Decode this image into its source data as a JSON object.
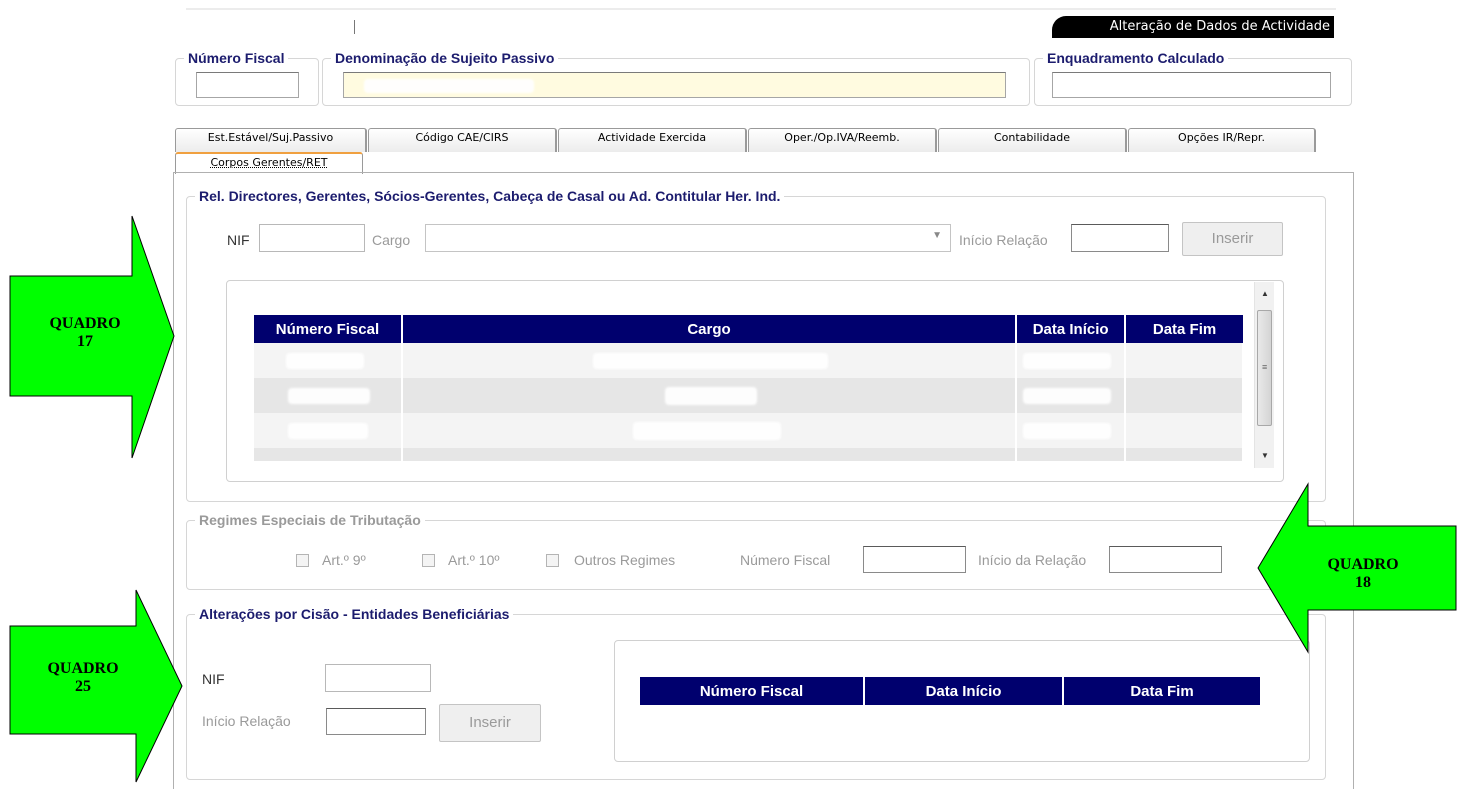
{
  "window": {
    "title": "Alteração de Dados de Actividade"
  },
  "header": {
    "numero_fiscal_label": "Número Fiscal",
    "denominacao_label": "Denominação de Sujeito Passivo",
    "enquadramento_label": "Enquadramento Calculado"
  },
  "tabs": [
    {
      "label": "Est.Estável/Suj.Passivo"
    },
    {
      "label": "Código CAE/CIRS"
    },
    {
      "label": "Actividade Exercida"
    },
    {
      "label": "Oper./Op.IVA/Reemb."
    },
    {
      "label": "Contabilidade"
    },
    {
      "label": "Opções IR/Repr."
    },
    {
      "label": "Corpos Gerentes/RET",
      "active": true
    }
  ],
  "quadro17": {
    "legend": "Rel. Directores, Gerentes, Sócios-Gerentes, Cabeça de Casal ou Ad. Contitular Her. Ind.",
    "nif_label": "NIF",
    "cargo_label": "Cargo",
    "inicio_relacao_label": "Início Relação",
    "inserir_label": "Inserir",
    "columns": [
      "Número Fiscal",
      "Cargo",
      "Data Início",
      "Data Fim"
    ]
  },
  "quadro18": {
    "legend": "Regimes Especiais de Tributação",
    "art9_label": "Art.º 9º",
    "art10_label": "Art.º 10º",
    "outros_label": "Outros Regimes",
    "numero_fiscal_label": "Número Fiscal",
    "inicio_relacao_label": "Início da Relação"
  },
  "quadro25": {
    "legend": "Alterações por Cisão - Entidades Beneficiárias",
    "nif_label": "NIF",
    "inicio_relacao_label": "Início Relação",
    "inserir_label": "Inserir",
    "columns": [
      "Número Fiscal",
      "Data Início",
      "Data Fim"
    ]
  },
  "annotations": {
    "q17_line1": "QUADRO",
    "q17_line2": "17",
    "q18_line1": "QUADRO",
    "q18_line2": "18",
    "q25_line1": "QUADRO",
    "q25_line2": "25",
    "arrow_color": "#00ff00"
  }
}
